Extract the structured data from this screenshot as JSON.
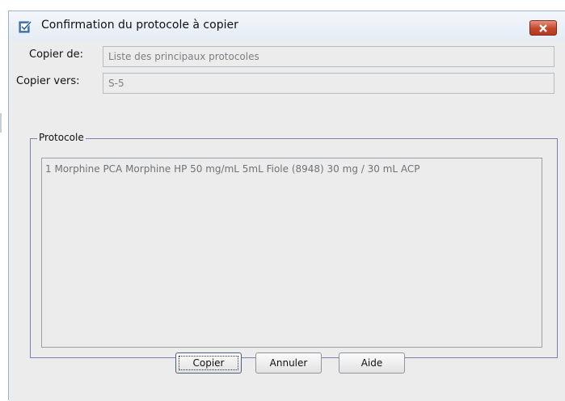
{
  "window": {
    "title": "Confirmation du protocole à copier",
    "title_icon": "dialog-check-icon",
    "close_icon": "close-icon",
    "colors": {
      "close_button": "#c4452a",
      "group_border": "#7b80b3"
    }
  },
  "form": {
    "copy_from_label": "Copier de:",
    "copy_from_value": "Liste des principaux protocoles",
    "copy_to_label": "Copier vers:",
    "copy_to_value": "S-5"
  },
  "protocol": {
    "group_title": "Protocole",
    "items": [
      "1 Morphine PCA Morphine HP  50 mg/mL   5mL Fiole (8948) 30 mg / 30 mL ACP"
    ]
  },
  "buttons": {
    "copy_label": "Copier",
    "cancel_label": "Annuler",
    "help_label": "Aide"
  }
}
